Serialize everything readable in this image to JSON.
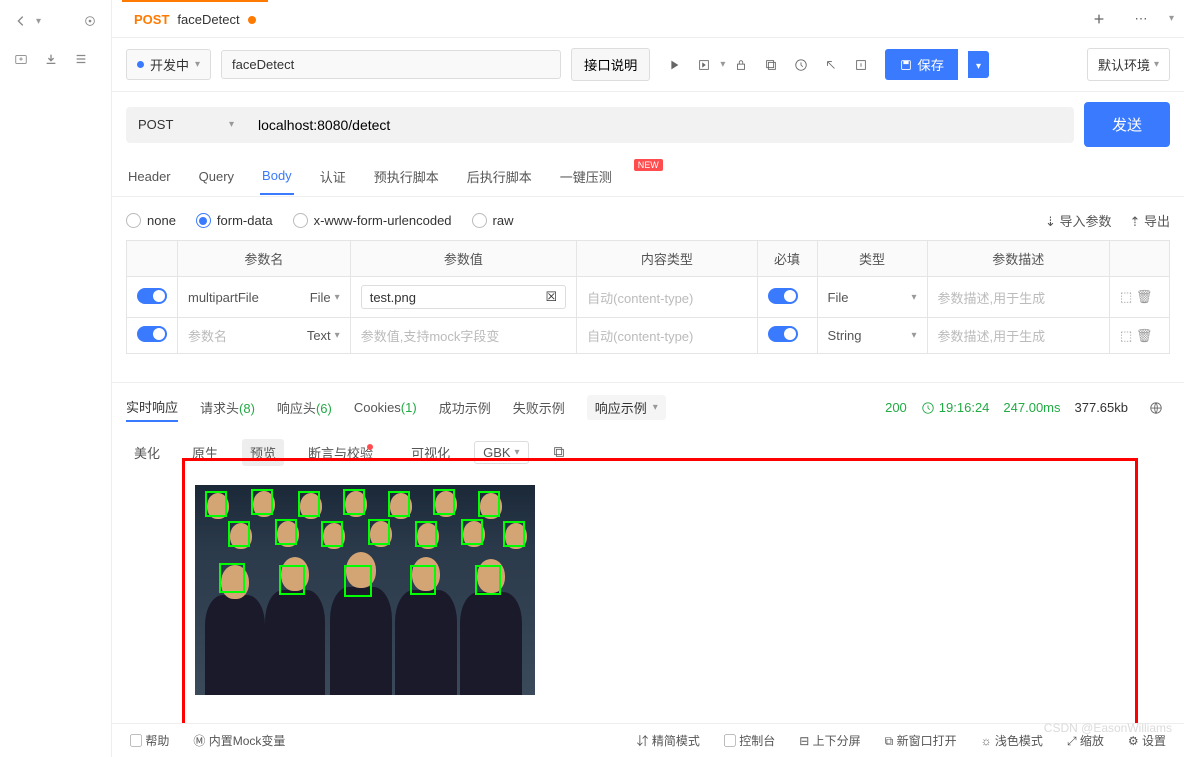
{
  "tab": {
    "method": "POST",
    "name": "faceDetect"
  },
  "status": {
    "label": "开发中"
  },
  "apiName": "faceDetect",
  "buttons": {
    "apiDesc": "接口说明",
    "save": "保存",
    "env": "默认环境",
    "send": "发送",
    "importParams": "导入参数",
    "exportParams": "导出"
  },
  "methodSelect": "POST",
  "url": "localhost:8080/detect",
  "reqTabs": {
    "header": "Header",
    "query": "Query",
    "body": "Body",
    "auth": "认证",
    "preScript": "预执行脚本",
    "postScript": "后执行脚本",
    "pressure": "一键压测",
    "badge": "NEW"
  },
  "bodyTypes": {
    "none": "none",
    "formData": "form-data",
    "urlencoded": "x-www-form-urlencoded",
    "raw": "raw"
  },
  "paramHeaders": {
    "name": "参数名",
    "value": "参数值",
    "contentType": "内容类型",
    "required": "必填",
    "type": "类型",
    "desc": "参数描述"
  },
  "params": [
    {
      "name": "multipartFile",
      "nameType": "File",
      "value": "test.png",
      "contentType": "自动(content-type)",
      "type": "File",
      "desc": "参数描述,用于生成"
    },
    {
      "name": "",
      "namePh": "参数名",
      "nameType": "Text",
      "value": "",
      "valuePh": "参数值,支持mock字段变",
      "contentType": "自动(content-type)",
      "type": "String",
      "desc": "参数描述,用于生成"
    }
  ],
  "respTabs": {
    "realtime": "实时响应",
    "reqHeaders": "请求头",
    "reqHeadersCount": "(8)",
    "respHeaders": "响应头",
    "respHeadersCount": "(6)",
    "cookies": "Cookies",
    "cookiesCount": "(1)",
    "success": "成功示例",
    "fail": "失败示例",
    "example": "响应示例"
  },
  "respMeta": {
    "status": "200",
    "time": "19:16:24",
    "duration": "247.00ms",
    "size": "377.65kb"
  },
  "viewModes": {
    "beautify": "美化",
    "raw": "原生",
    "preview": "预览",
    "assert": "断言与校验",
    "visualize": "可视化",
    "encoding": "GBK"
  },
  "bottom": {
    "help": "帮助",
    "mock": "内置Mock变量",
    "compact": "精简模式",
    "console": "控制台",
    "split": "上下分屏",
    "newWindow": "新窗口打开",
    "theme": "浅色模式",
    "zoom": "缩放",
    "settings": "设置"
  },
  "watermark": "CSDN @EasonWilliams"
}
